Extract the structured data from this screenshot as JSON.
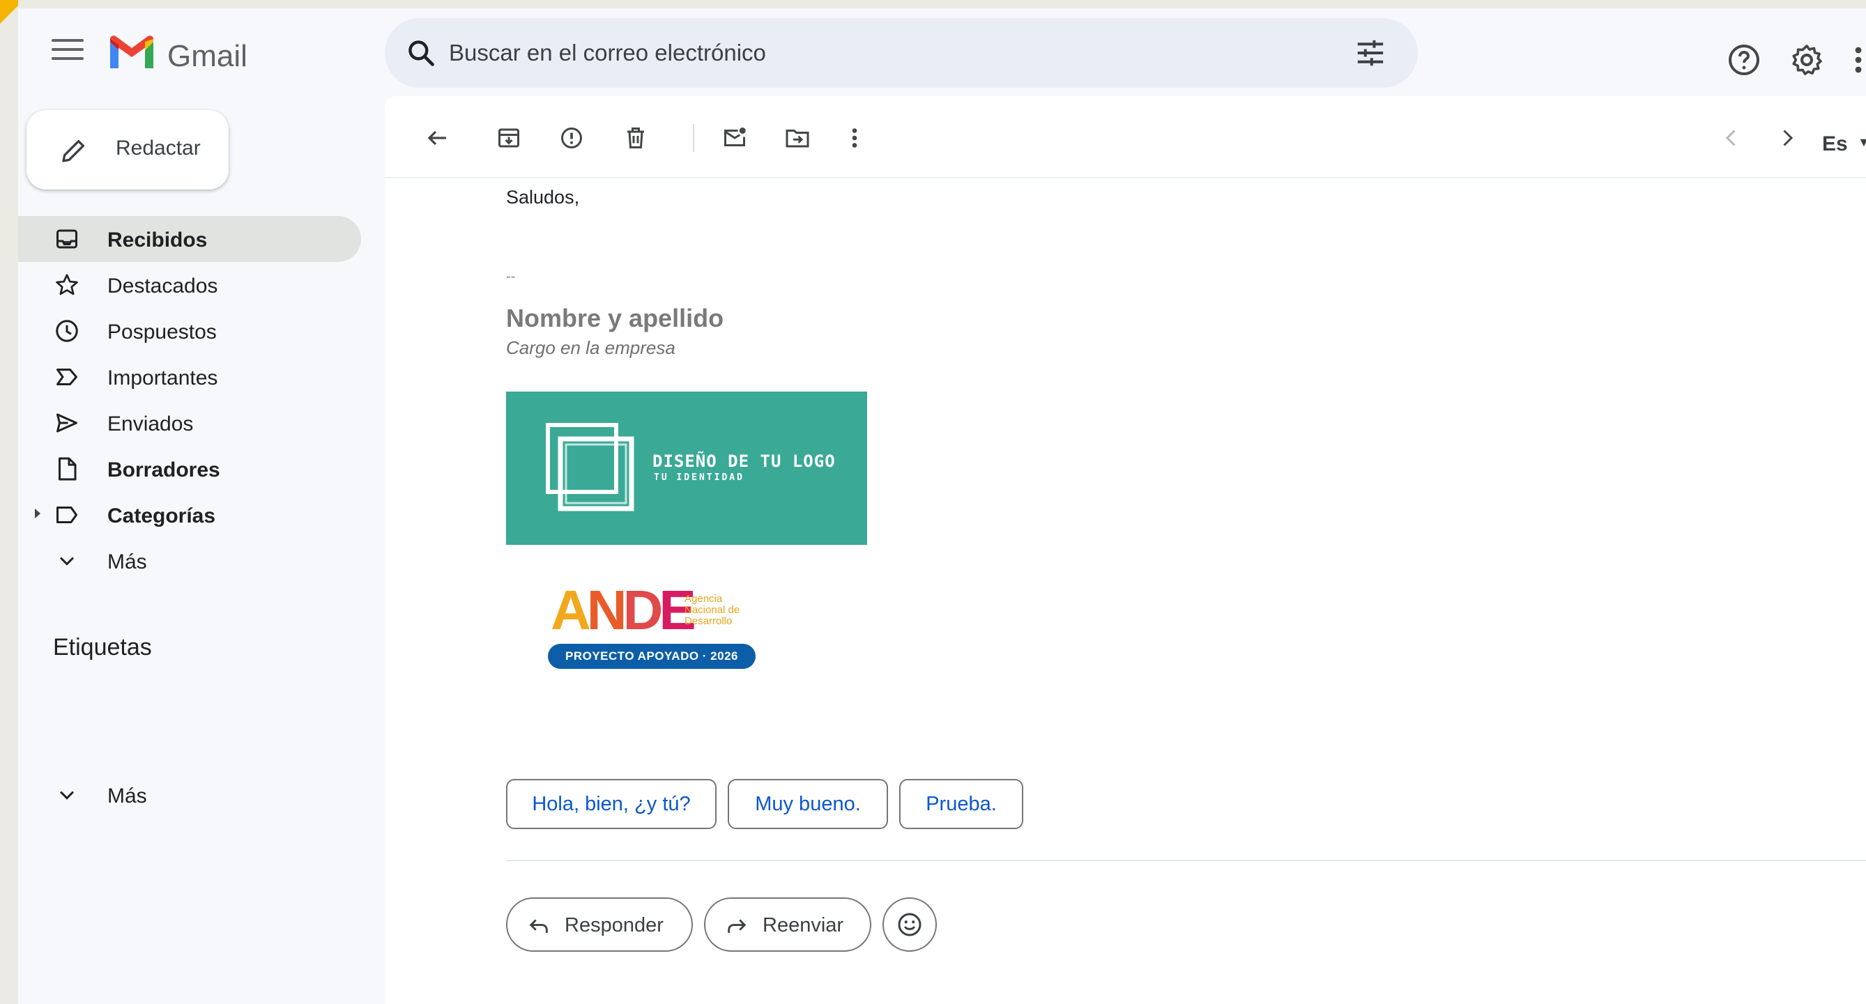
{
  "app": {
    "name": "Gmail"
  },
  "search": {
    "placeholder": "Buscar en el correo electrónico"
  },
  "sidebar": {
    "compose_label": "Redactar",
    "items": [
      {
        "label": "Recibidos",
        "icon": "inbox-icon",
        "active": true,
        "bold": true
      },
      {
        "label": "Destacados",
        "icon": "star-icon"
      },
      {
        "label": "Pospuestos",
        "icon": "clock-icon"
      },
      {
        "label": "Importantes",
        "icon": "label-important-icon"
      },
      {
        "label": "Enviados",
        "icon": "send-icon"
      },
      {
        "label": "Borradores",
        "icon": "draft-icon",
        "bold": true
      },
      {
        "label": "Categorías",
        "icon": "label-icon",
        "bold": true
      },
      {
        "label": "Más",
        "icon": "chevron-down-icon"
      }
    ],
    "labels_title": "Etiquetas",
    "more_label": "Más"
  },
  "toolbar": {
    "language": "Es"
  },
  "message": {
    "greeting": "Saludos,",
    "sig_separator": "--",
    "signature_name": "Nombre y apellido",
    "signature_role": "Cargo en la empresa",
    "banner_title": "DISEÑO DE TU LOGO",
    "banner_subtitle": "TU IDENTIDAD",
    "ande_logo": {
      "letters": [
        "A",
        "N",
        "D",
        "E"
      ],
      "subtitle_lines": [
        "Agencia",
        "Nacional de",
        "Desarrollo"
      ],
      "pill": "PROYECTO APOYADO · 2026"
    }
  },
  "smart_replies": [
    "Hola, bien, ¿y tú?",
    "Muy bueno.",
    "Prueba."
  ],
  "actions": {
    "reply": "Responder",
    "forward": "Reenviar"
  },
  "colors": {
    "accent_blue": "#0b57d0",
    "banner_teal": "#3aa996",
    "ande_pill": "#0d5ea8"
  }
}
